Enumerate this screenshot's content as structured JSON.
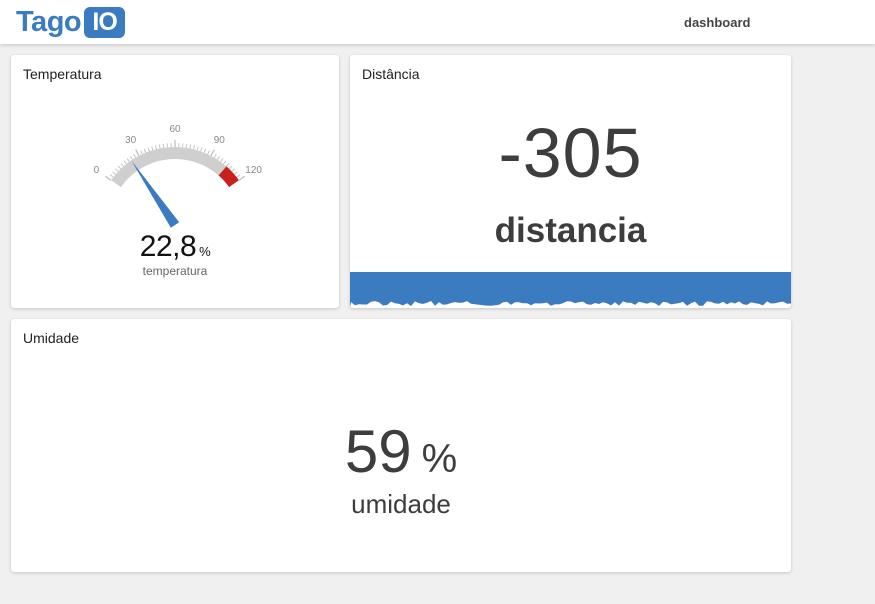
{
  "header": {
    "logo_text": "Tago",
    "logo_box": "IO",
    "nav_label": "dashboard",
    "brand_color": "#3b7bbf"
  },
  "temperatura": {
    "title": "Temperatura",
    "value": "22,8",
    "numeric_value": 22.8,
    "unit": "%",
    "variable": "temperatura",
    "gauge": {
      "min": 0,
      "max": 120,
      "ticks": [
        "0",
        "30",
        "60",
        "90",
        "120"
      ],
      "red_zone": [
        105,
        120
      ],
      "needle_color": "#3b7bbf",
      "arc_color": "#cfcfcf",
      "red_color": "#c8201f"
    }
  },
  "distancia": {
    "title": "Distância",
    "value": "-305",
    "variable": "distancia",
    "wave_color": "#3b7bbf"
  },
  "umidade": {
    "title": "Umidade",
    "value": "59",
    "unit": "%",
    "variable": "umidade"
  }
}
